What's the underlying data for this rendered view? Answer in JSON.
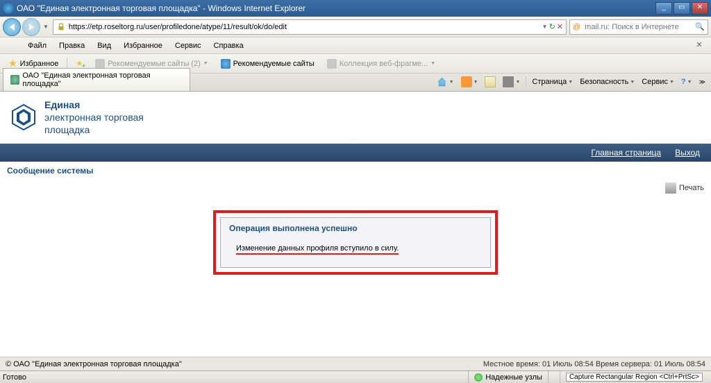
{
  "window": {
    "title": "ОАО \"Единая электронная торговая площадка\" - Windows Internet Explorer"
  },
  "nav": {
    "url": "https://etp.roseltorg.ru/user/profiledone/atype/11/result/ok/do/edit",
    "search_placeholder": "mail.ru: Поиск в Интернете"
  },
  "menu": {
    "file": "Файл",
    "edit": "Правка",
    "view": "Вид",
    "favorites": "Избранное",
    "service": "Сервис",
    "help": "Справка"
  },
  "favbar": {
    "favorites": "Избранное",
    "recommended_sites_count": "Рекомендуемые сайты (2)",
    "recommended_sites": "Рекомендуемые сайты",
    "web_fragments": "Коллекция веб-фрагме..."
  },
  "tab": {
    "title": "ОАО \"Единая электронная торговая площадка\""
  },
  "commandbar": {
    "page": "Страница",
    "safety": "Безопасность",
    "service": "Сервис"
  },
  "brand": {
    "line1": "Единая",
    "line2": "электронная торговая",
    "line3": "площадка"
  },
  "topnav": {
    "home": "Главная страница",
    "exit": "Выход"
  },
  "system_message_label": "Сообщение системы",
  "print_label": "Печать",
  "panel": {
    "title": "Операция выполнена успешно",
    "message": "Изменение данных профиля вступило в силу."
  },
  "footer": {
    "copyright": "© ОАО \"Единая электронная торговая площадка\"",
    "local_time_label": "Местное время:",
    "local_time": "01 Июль 08:54",
    "server_time_label": "Время сервера:",
    "server_time": "01 Июль 08:54"
  },
  "status": {
    "ready": "Готово",
    "trusted": "Надежные узлы",
    "capture": "Capture Rectangular Region <Ctrl+PrtSc>"
  }
}
